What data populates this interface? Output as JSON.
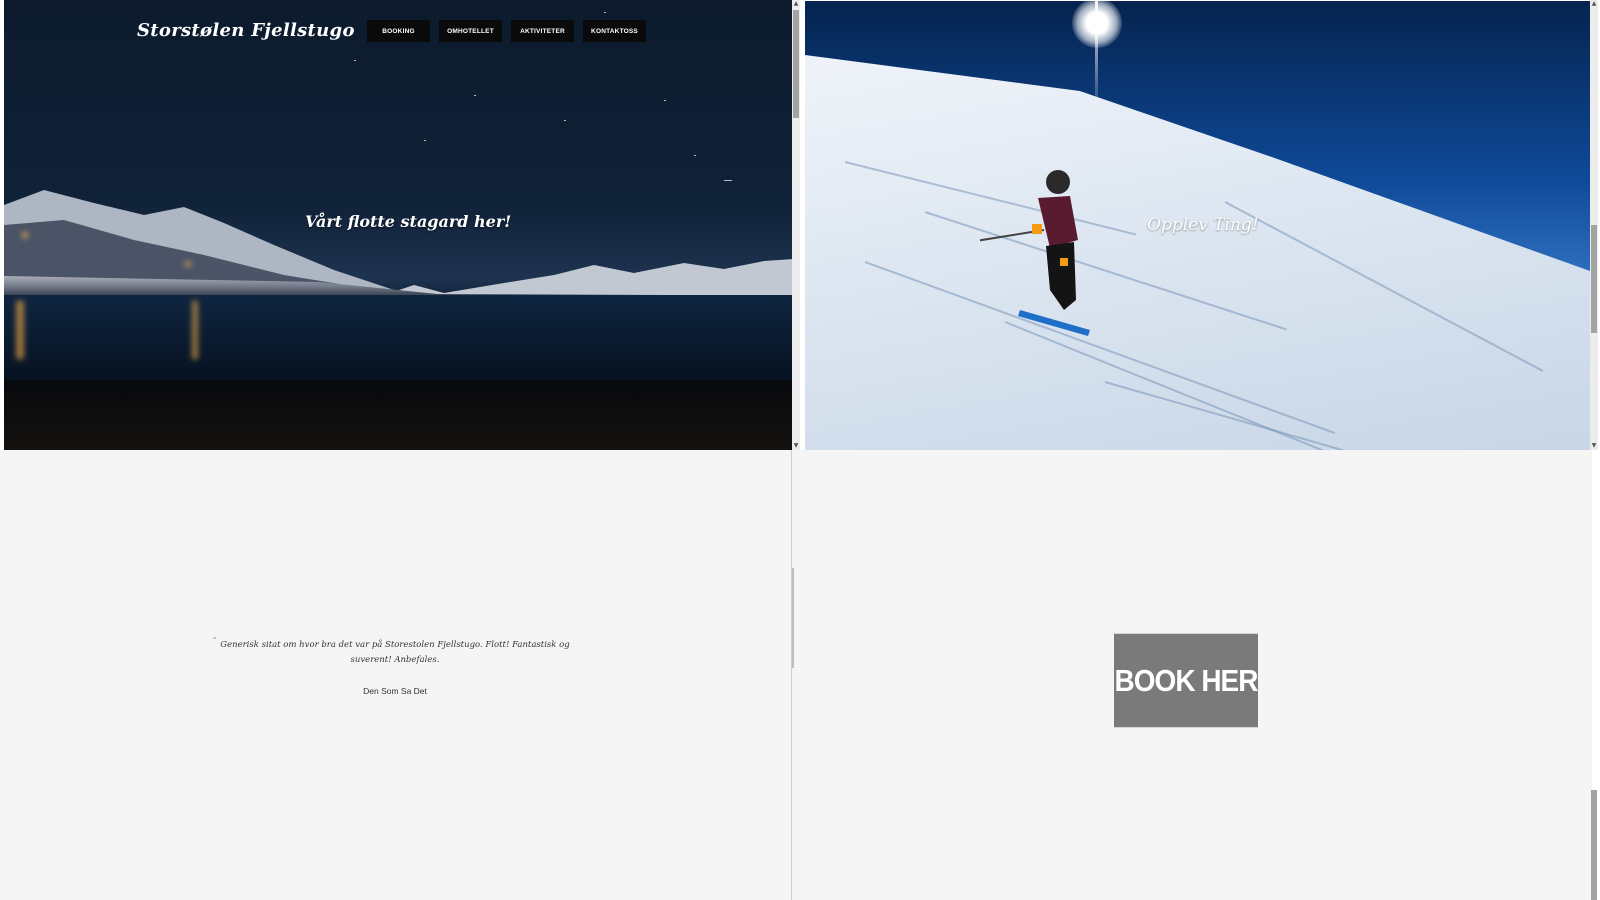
{
  "top_left": {
    "logo": "Storstølen Fjellstugo",
    "nav": [
      {
        "label": "BOOKING"
      },
      {
        "label": "OMHOTELLET"
      },
      {
        "label": "AKTIVITETER"
      },
      {
        "label": "KONTAKTOSS"
      }
    ],
    "hero_title": "Vårt flotte stagard her!"
  },
  "top_right": {
    "hero_title": "Opplev Ting!"
  },
  "bottom_left": {
    "quote": "Generisk sitat om hvor bra det var på Storestolen Fjellstugo. Flott! Fantastisk og suverent! Anbefales.",
    "author": "Den Som Sa Det"
  },
  "bottom_right": {
    "book_label": "BOOK HER"
  },
  "colors": {
    "nav_bg": "#0a0a0a",
    "book_btn_bg": "#7a7a7a",
    "page_bg": "#f5f5f5"
  }
}
